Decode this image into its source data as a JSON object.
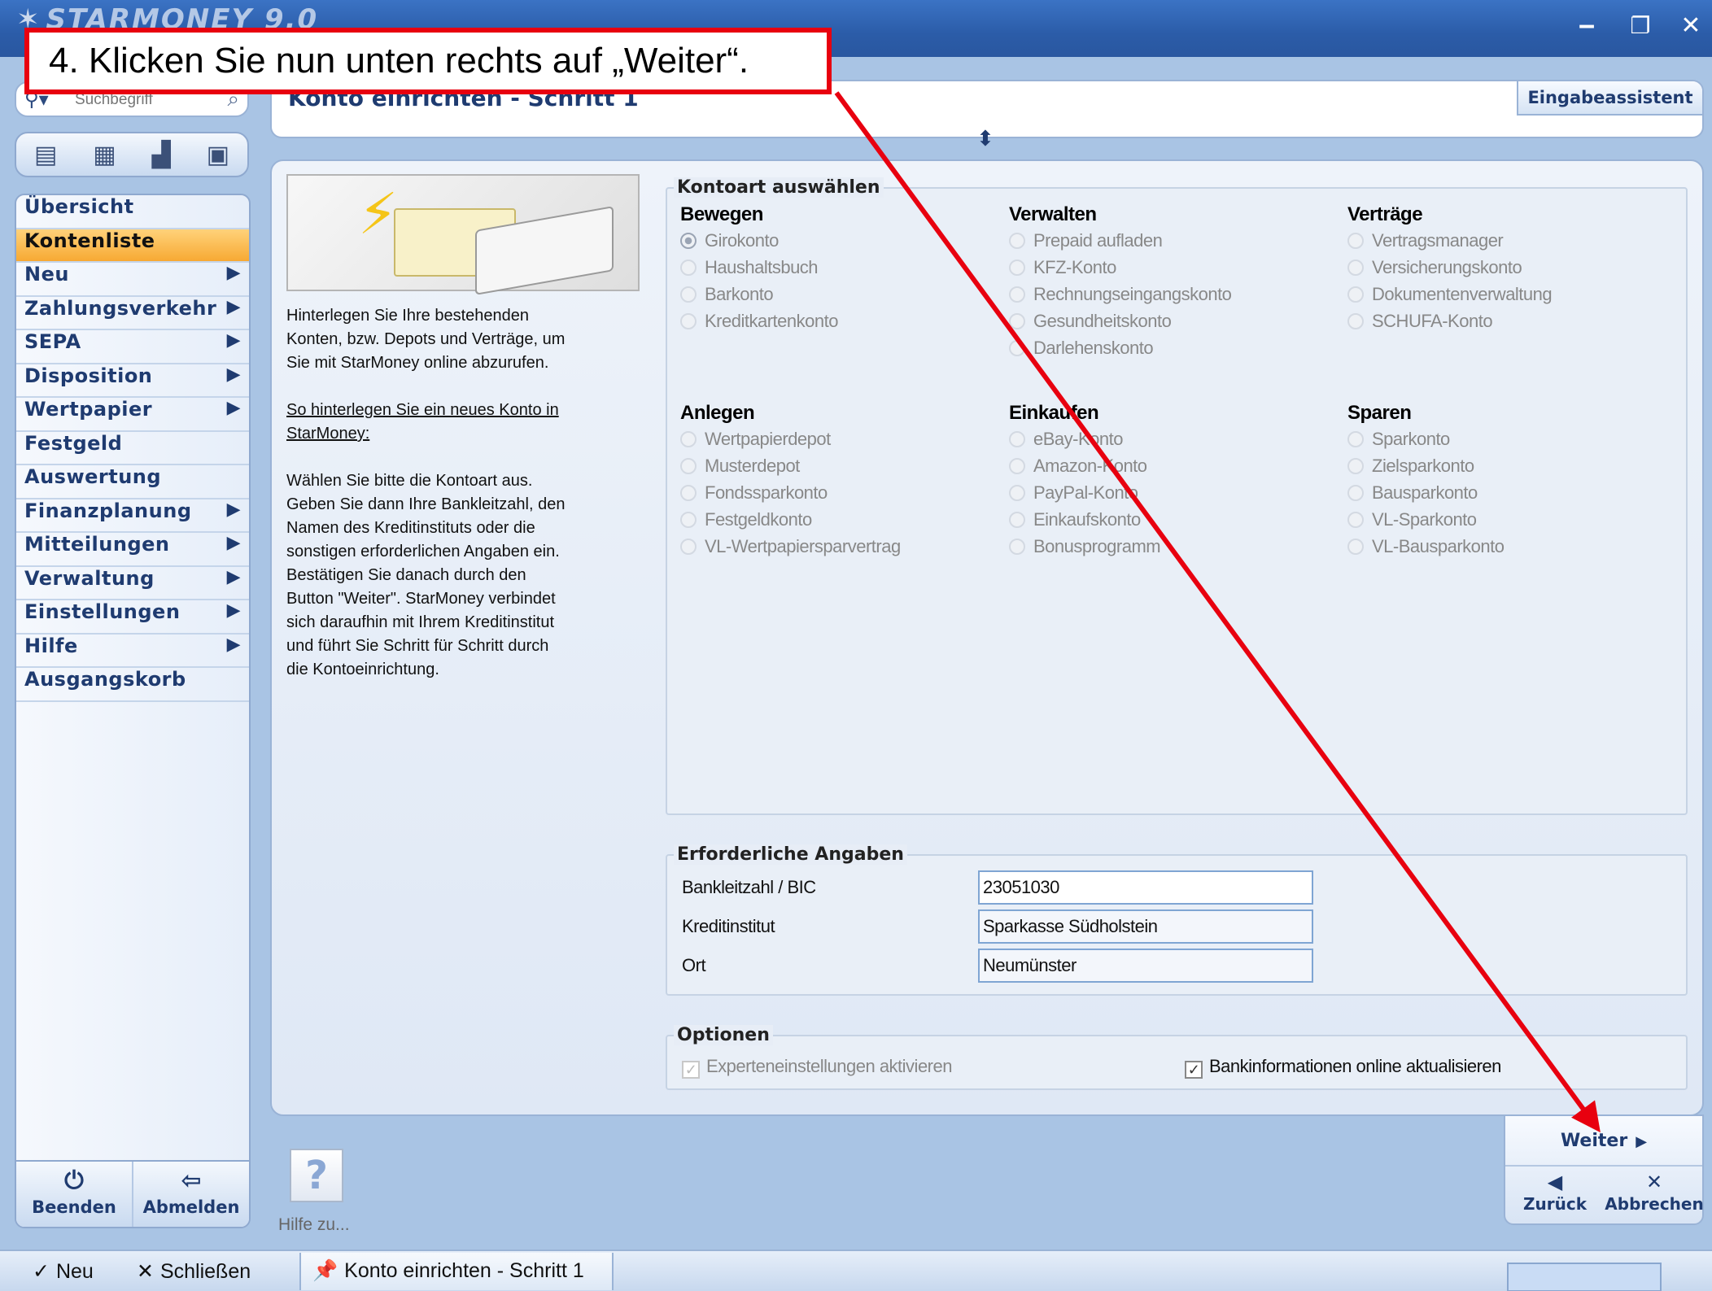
{
  "window": {
    "app_title": "STARMONEY 9.0",
    "controls": {
      "minimize": "‒",
      "maximize": "❐",
      "close": "✕"
    }
  },
  "annotation": {
    "callout_text": "4. Klicken Sie nun unten rechts auf „Weiter“.",
    "color": "#e8000f"
  },
  "search": {
    "placeholder": "Suchbegriff"
  },
  "sidebar": {
    "toolbar_icons": [
      "document-list-icon",
      "calendar-icon",
      "chart-icon",
      "calculator-icon"
    ],
    "items": [
      {
        "label": "Übersicht",
        "has_submenu": false,
        "active": false
      },
      {
        "label": "Kontenliste",
        "has_submenu": false,
        "active": true
      },
      {
        "label": "Neu",
        "has_submenu": true,
        "active": false
      },
      {
        "label": "Zahlungsverkehr",
        "has_submenu": true,
        "active": false
      },
      {
        "label": "SEPA",
        "has_submenu": true,
        "active": false
      },
      {
        "label": "Disposition",
        "has_submenu": true,
        "active": false
      },
      {
        "label": "Wertpapier",
        "has_submenu": true,
        "active": false
      },
      {
        "label": "Festgeld",
        "has_submenu": false,
        "active": false
      },
      {
        "label": "Auswertung",
        "has_submenu": false,
        "active": false
      },
      {
        "label": "Finanzplanung",
        "has_submenu": true,
        "active": false
      },
      {
        "label": "Mitteilungen",
        "has_submenu": true,
        "active": false
      },
      {
        "label": "Verwaltung",
        "has_submenu": true,
        "active": false
      },
      {
        "label": "Einstellungen",
        "has_submenu": true,
        "active": false
      },
      {
        "label": "Hilfe",
        "has_submenu": true,
        "active": false
      },
      {
        "label": "Ausgangskorb",
        "has_submenu": false,
        "active": false
      }
    ],
    "bottom": {
      "quit_label": "Beenden",
      "logout_label": "Abmelden"
    }
  },
  "header": {
    "title": "Konto einrichten - Schritt 1",
    "assistant_label": "Eingabeassistent"
  },
  "info": {
    "intro": "Hinterlegen Sie Ihre bestehenden Konten, bzw. Depots und Verträge, um Sie mit StarMoney online abzurufen.",
    "link": "So hinterlegen Sie ein neues Konto in StarMoney:",
    "instructions": "Wählen Sie bitte die Kontoart aus. Geben Sie dann Ihre Bankleitzahl, den Namen des Kreditinstituts oder die sonstigen erforderlichen Angaben ein. Bestätigen Sie danach durch den Button \"Weiter\". StarMoney verbindet sich daraufhin mit Ihrem Kreditinstitut und führt Sie Schritt für Schritt durch die Kontoeinrichtung."
  },
  "account_type": {
    "group_title": "Kontoart auswählen",
    "columns_top": [
      {
        "title": "Bewegen",
        "options": [
          "Girokonto",
          "Haushaltsbuch",
          "Barkonto",
          "Kreditkartenkonto"
        ]
      },
      {
        "title": "Verwalten",
        "options": [
          "Prepaid aufladen",
          "KFZ-Konto",
          "Rechnungseingangskonto",
          "Gesundheitskonto",
          "Darlehenskonto"
        ]
      },
      {
        "title": "Verträge",
        "options": [
          "Vertragsmanager",
          "Versicherungskonto",
          "Dokumentenverwaltung",
          "SCHUFA-Konto"
        ]
      }
    ],
    "columns_bottom": [
      {
        "title": "Anlegen",
        "options": [
          "Wertpapierdepot",
          "Musterdepot",
          "Fondssparkonto",
          "Festgeldkonto",
          "VL-Wertpapiersparvertrag"
        ]
      },
      {
        "title": "Einkaufen",
        "options": [
          "eBay-Konto",
          "Amazon-Konto",
          "PayPal-Konto",
          "Einkaufskonto",
          "Bonusprogramm"
        ]
      },
      {
        "title": "Sparen",
        "options": [
          "Sparkonto",
          "Zielsparkonto",
          "Bausparkonto",
          "VL-Sparkonto",
          "VL-Bausparkonto"
        ]
      }
    ],
    "selected": "Girokonto"
  },
  "required": {
    "group_title": "Erforderliche Angaben",
    "fields": [
      {
        "label": "Bankleitzahl / BIC",
        "value": "23051030"
      },
      {
        "label": "Kreditinstitut",
        "value": "Sparkasse Südholstein"
      },
      {
        "label": "Ort",
        "value": "Neumünster"
      }
    ]
  },
  "options": {
    "group_title": "Optionen",
    "expert_label": "Experteneinstellungen aktivieren",
    "expert_checked": true,
    "bankinfo_label": "Bankinformationen online aktualisieren",
    "bankinfo_checked": true
  },
  "help": {
    "label": "Hilfe zu..."
  },
  "buttons": {
    "next_label": "Weiter",
    "back_label": "Zurück",
    "cancel_label": "Abbrechen"
  },
  "taskbar": {
    "new_label": "Neu",
    "close_label": "Schließen",
    "tab_label": "Konto einrichten - Schritt 1"
  }
}
